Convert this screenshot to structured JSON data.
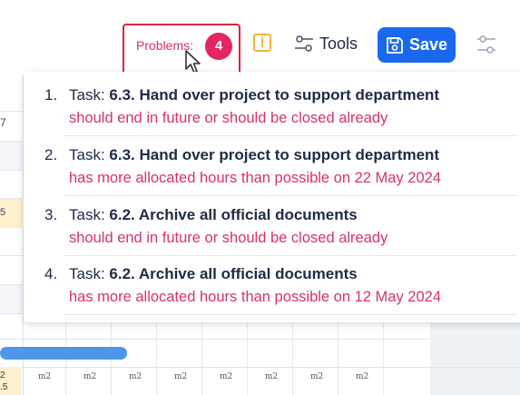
{
  "grid": {
    "left_cells": [
      "7",
      "5",
      "2",
      ".5"
    ],
    "bottom_cells": [
      "m2",
      "m2",
      "m2",
      "m2",
      "m2",
      "m2",
      "m2",
      "m2",
      "m2"
    ]
  },
  "toolbar": {
    "problems_label": "Problems:",
    "problems_count": "4",
    "info_icon": "info-icon",
    "tools_label": "Tools",
    "save_label": "Save",
    "settings_icon": "sliders-icon",
    "accent_color": "#1a68ee",
    "problem_color": "#e5255f"
  },
  "problems": [
    {
      "num": "1.",
      "prefix": "Task: ",
      "task": "6.3. Hand over project to support department",
      "message": "should end in future or should be closed already"
    },
    {
      "num": "2.",
      "prefix": "Task: ",
      "task": "6.3. Hand over project to support department",
      "message": "has more allocated hours than possible on 22 May 2024"
    },
    {
      "num": "3.",
      "prefix": "Task: ",
      "task": "6.2. Archive all official documents",
      "message": "should end in future or should be closed already"
    },
    {
      "num": "4.",
      "prefix": "Task: ",
      "task": "6.2. Archive all official documents",
      "message": "has more allocated hours than possible on 12 May 2024"
    }
  ]
}
